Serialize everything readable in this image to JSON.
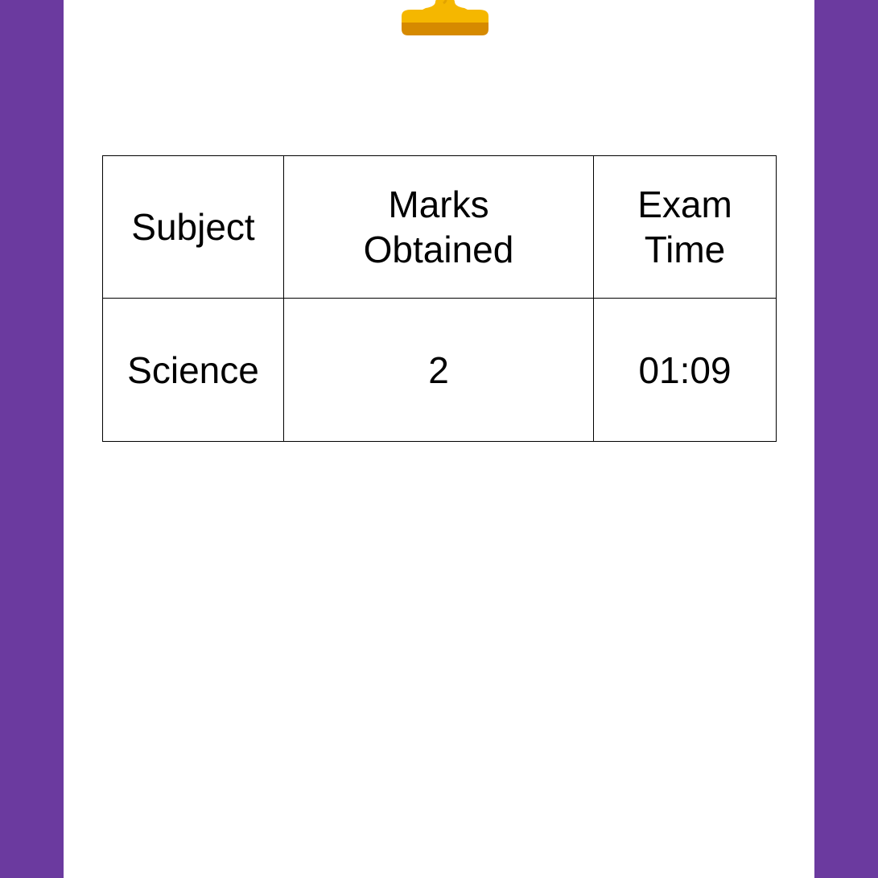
{
  "colors": {
    "background": "#6b3a9f",
    "panel": "#ffffff",
    "trophy_gold": "#f5b700",
    "trophy_shadow": "#d68a00"
  },
  "trophy": {
    "icon": "trophy-icon"
  },
  "results_table": {
    "headers": {
      "subject": "Subject",
      "marks_line1": "Marks",
      "marks_line2": "Obtained",
      "time_line1": "Exam",
      "time_line2": "Time"
    },
    "rows": [
      {
        "subject": "Science",
        "marks": "2",
        "time": "01:09"
      }
    ]
  }
}
